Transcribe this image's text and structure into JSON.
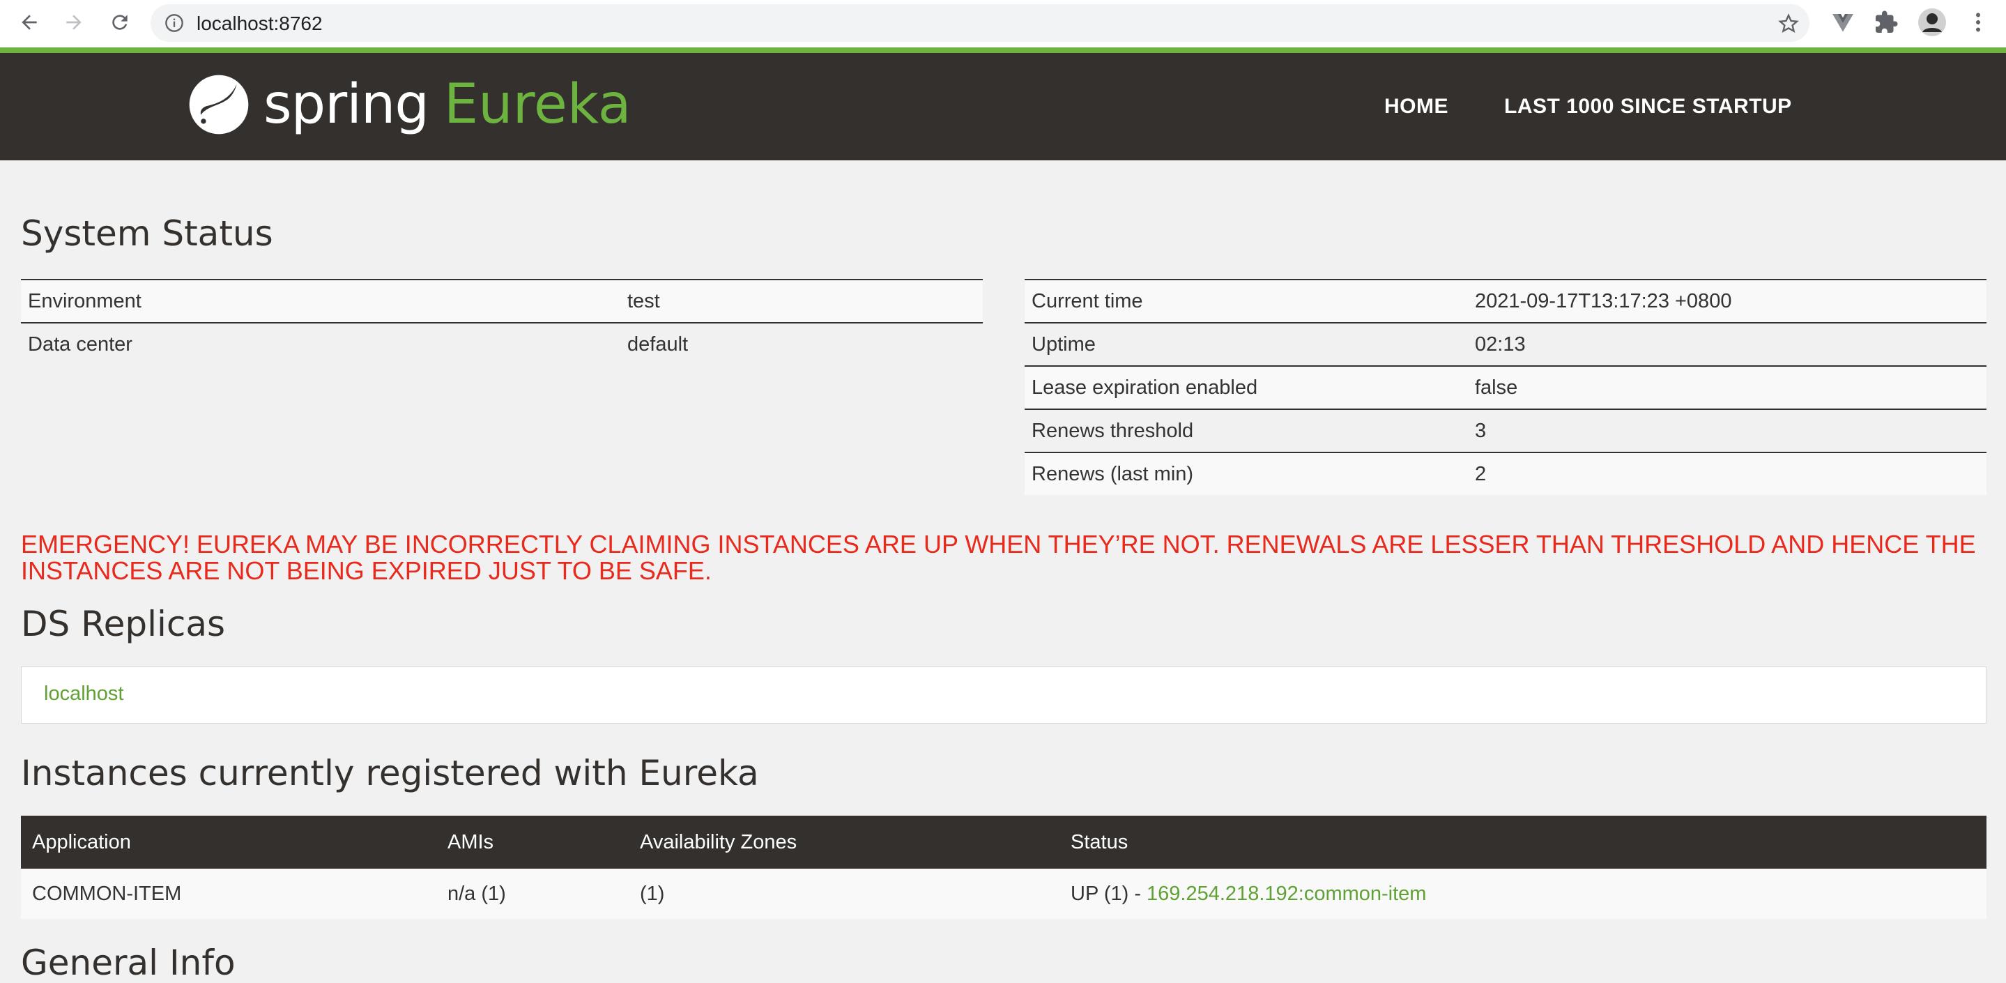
{
  "browser": {
    "url": "localhost:8762",
    "icons": [
      "back-icon",
      "forward-icon",
      "reload-icon",
      "info-icon",
      "star-icon",
      "vue-devtools-icon",
      "extensions-icon",
      "avatar",
      "menu-icon"
    ]
  },
  "header": {
    "brand": "spring",
    "product": "Eureka",
    "nav": [
      {
        "label": "HOME"
      },
      {
        "label": "LAST 1000 SINCE STARTUP"
      }
    ]
  },
  "system_status": {
    "title": "System Status",
    "left": [
      {
        "key": "Environment",
        "value": "test"
      },
      {
        "key": "Data center",
        "value": "default"
      }
    ],
    "right": [
      {
        "key": "Current time",
        "value": "2021-09-17T13:17:23 +0800"
      },
      {
        "key": "Uptime",
        "value": "02:13"
      },
      {
        "key": "Lease expiration enabled",
        "value": "false"
      },
      {
        "key": "Renews threshold",
        "value": "3"
      },
      {
        "key": "Renews (last min)",
        "value": "2"
      }
    ]
  },
  "emergency": "EMERGENCY! EUREKA MAY BE INCORRECTLY CLAIMING INSTANCES ARE UP WHEN THEY’RE NOT. RENEWALS ARE LESSER THAN THRESHOLD AND HENCE THE INSTANCES ARE NOT BEING EXPIRED JUST TO BE SAFE.",
  "ds_replicas": {
    "title": "DS Replicas",
    "link": "localhost"
  },
  "instances": {
    "title": "Instances currently registered with Eureka",
    "columns": [
      "Application",
      "AMIs",
      "Availability Zones",
      "Status"
    ],
    "rows": [
      {
        "application": "COMMON-ITEM",
        "amis": "n/a (1)",
        "zones": "(1)",
        "status_prefix": "UP (1) - ",
        "status_link": "169.254.218.192:common-item"
      }
    ]
  },
  "next_section_title": "General Info",
  "colors": {
    "accent": "#6db33f",
    "header_bg": "#34302d",
    "emergency": "#e8291c",
    "link": "#5fa134"
  }
}
